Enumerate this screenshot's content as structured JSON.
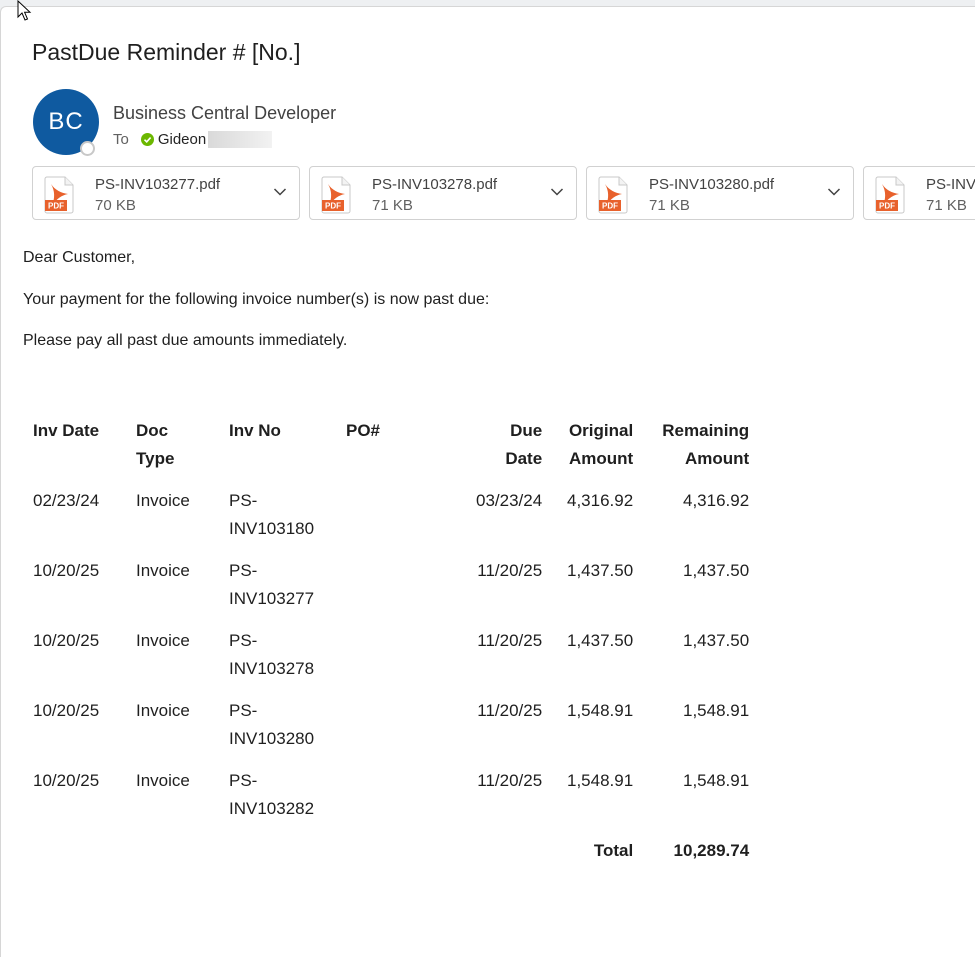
{
  "email": {
    "subject": "PastDue Reminder # [No.]",
    "avatar_initials": "BC",
    "sender": "Business Central Developer",
    "to_label": "To",
    "recipient": "Gideon"
  },
  "attachments": [
    {
      "name": "PS-INV103277.pdf",
      "size": "70 KB",
      "icon_label": "PDF"
    },
    {
      "name": "PS-INV103278.pdf",
      "size": "71 KB",
      "icon_label": "PDF"
    },
    {
      "name": "PS-INV103280.pdf",
      "size": "71 KB",
      "icon_label": "PDF"
    },
    {
      "name": "PS-INV",
      "size": "71 KB",
      "icon_label": "PDF"
    }
  ],
  "body": {
    "greeting": "Dear Customer,",
    "line1": "Your payment for the following invoice number(s) is now past due:",
    "line2": "Please pay all past due amounts immediately."
  },
  "table": {
    "headers": {
      "inv_date": "Inv Date",
      "doc_type_1": "Doc",
      "doc_type_2": "Type",
      "inv_no": "Inv No",
      "po": "PO#",
      "due_1": "Due",
      "due_2": "Date",
      "orig_1": "Original",
      "orig_2": "Amount",
      "rem_1": "Remaining",
      "rem_2": "Amount"
    },
    "rows": [
      {
        "inv_date": "02/23/24",
        "doc_type": "Invoice",
        "inv_no_1": "PS-",
        "inv_no_2": "INV103180",
        "po": "",
        "due_date": "03/23/24",
        "original": "4,316.92",
        "remaining": "4,316.92"
      },
      {
        "inv_date": "10/20/25",
        "doc_type": "Invoice",
        "inv_no_1": "PS-",
        "inv_no_2": "INV103277",
        "po": "",
        "due_date": "11/20/25",
        "original": "1,437.50",
        "remaining": "1,437.50"
      },
      {
        "inv_date": "10/20/25",
        "doc_type": "Invoice",
        "inv_no_1": "PS-",
        "inv_no_2": "INV103278",
        "po": "",
        "due_date": "11/20/25",
        "original": "1,437.50",
        "remaining": "1,437.50"
      },
      {
        "inv_date": "10/20/25",
        "doc_type": "Invoice",
        "inv_no_1": "PS-",
        "inv_no_2": "INV103280",
        "po": "",
        "due_date": "11/20/25",
        "original": "1,548.91",
        "remaining": "1,548.91"
      },
      {
        "inv_date": "10/20/25",
        "doc_type": "Invoice",
        "inv_no_1": "PS-",
        "inv_no_2": "INV103282",
        "po": "",
        "due_date": "11/20/25",
        "original": "1,548.91",
        "remaining": "1,548.91"
      }
    ],
    "total_label": "Total",
    "total_value": "10,289.74"
  },
  "colors": {
    "avatar": "#0f5aa0",
    "pdf_icon": "#e8612c",
    "presence_check": "#6bb700"
  }
}
